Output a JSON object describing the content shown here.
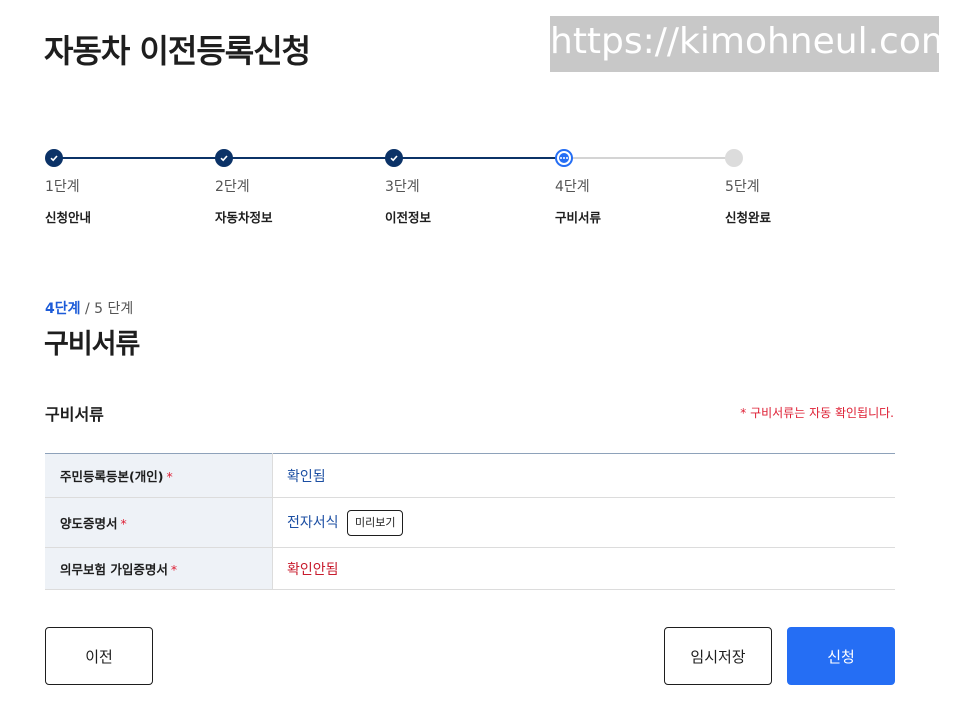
{
  "page": {
    "title": "자동차 이전등록신청"
  },
  "watermark": {
    "text": "https://kimohneul.com"
  },
  "stepper": {
    "steps": [
      {
        "num": "1단계",
        "name": "신청안내",
        "state": "done"
      },
      {
        "num": "2단계",
        "name": "자동차정보",
        "state": "done"
      },
      {
        "num": "3단계",
        "name": "이전정보",
        "state": "done"
      },
      {
        "num": "4단계",
        "name": "구비서류",
        "state": "current"
      },
      {
        "num": "5단계",
        "name": "신청완료",
        "state": "todo"
      }
    ]
  },
  "progress": {
    "current": "4단계",
    "total": "/ 5 단계"
  },
  "section": {
    "title": "구비서류",
    "subtitle": "구비서류",
    "notice": "* 구비서류는 자동 확인됩니다."
  },
  "documents": [
    {
      "name": "주민등록등본(개인)",
      "required_mark": "*",
      "status": "확인됨",
      "status_type": "ok"
    },
    {
      "name": "양도증명서",
      "required_mark": "*",
      "status": "전자서식",
      "status_type": "ok",
      "action": "미리보기"
    },
    {
      "name": "의무보험 가입증명서",
      "required_mark": "*",
      "status": "확인안됨",
      "status_type": "no"
    }
  ],
  "buttons": {
    "prev": "이전",
    "temp_save": "임시저장",
    "submit": "신청"
  },
  "colors": {
    "primary": "#256ef4",
    "navy": "#0b3267",
    "error": "#de1e33"
  }
}
